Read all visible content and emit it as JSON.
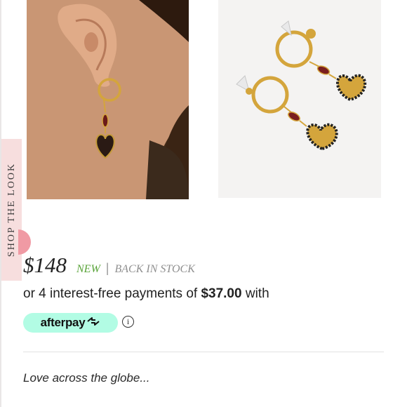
{
  "shop_tab": {
    "label": "SHOP THE LOOK"
  },
  "product": {
    "price": "$148",
    "new_label": "NEW",
    "separator": "|",
    "stock_label": "BACK IN STOCK",
    "installments": {
      "prefix": "or 4 interest-free payments of ",
      "amount": "$37.00",
      "suffix": " with"
    },
    "afterpay": {
      "label": "afterpay"
    },
    "info_glyph": "i",
    "tagline": "Love across the globe..."
  },
  "colors": {
    "afterpay_mint": "#b2fce4",
    "new_green": "#5aa43a",
    "shop_tab_pink": "#f7dede",
    "knob_pink": "#f09aa4",
    "gold": "#d4a53c",
    "garnet": "#7a1e1e"
  },
  "icons": [
    "model-photo",
    "earring-product-photo",
    "afterpay-logo-icon",
    "info-icon"
  ]
}
